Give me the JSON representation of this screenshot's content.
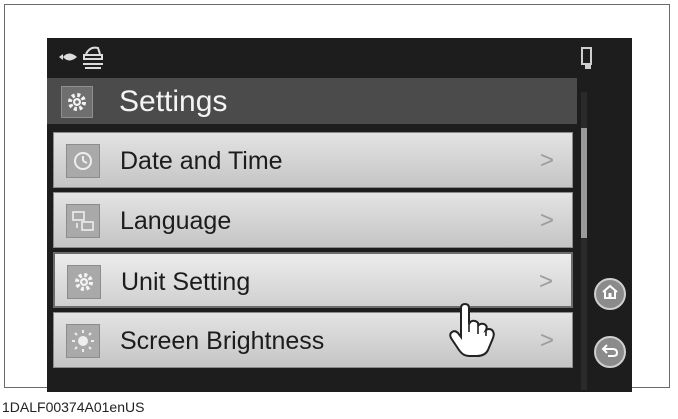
{
  "header": {
    "title": "Settings",
    "icon": "gear-icon"
  },
  "menu": {
    "items": [
      {
        "label": "Date and Time",
        "icon": "clock-icon",
        "chevron": ">"
      },
      {
        "label": "Language",
        "icon": "language-icon",
        "chevron": ">"
      },
      {
        "label": "Unit Setting",
        "icon": "gear-icon",
        "chevron": ">",
        "selected": true
      },
      {
        "label": "Screen Brightness",
        "icon": "brightness-icon",
        "chevron": ">"
      }
    ]
  },
  "side_buttons": [
    "home-icon",
    "back-icon"
  ],
  "caption": "1DALF00374A01enUS",
  "colors": {
    "screen_bg": "#1d1d1d",
    "header_bg": "#4b4b4b",
    "item_bg": "#d5d5d5"
  }
}
